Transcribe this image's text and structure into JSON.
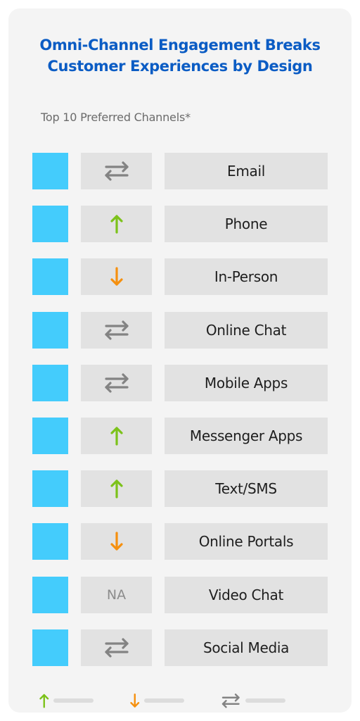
{
  "title_line1": "Omni-Channel Engagement Breaks",
  "title_line2": "Customer Experiences by Design",
  "subtitle": "Top 10 Preferred Channels*",
  "colors": {
    "swatch": "#44ccfc",
    "up": "#7cc21a",
    "down": "#f5900f",
    "same": "#838383",
    "title": "#0b5cc4"
  },
  "channels": [
    {
      "label": "Email",
      "trend": "same"
    },
    {
      "label": "Phone",
      "trend": "up"
    },
    {
      "label": "In-Person",
      "trend": "down"
    },
    {
      "label": "Online Chat",
      "trend": "same"
    },
    {
      "label": "Mobile Apps",
      "trend": "same"
    },
    {
      "label": "Messenger Apps",
      "trend": "up"
    },
    {
      "label": "Text/SMS",
      "trend": "up"
    },
    {
      "label": "Online Portals",
      "trend": "down"
    },
    {
      "label": "Video Chat",
      "trend": "na",
      "trend_text": "NA"
    },
    {
      "label": "Social Media",
      "trend": "same"
    }
  ],
  "legend": [
    {
      "icon": "arrow-up-icon",
      "trend": "up",
      "label": ""
    },
    {
      "icon": "arrow-down-icon",
      "trend": "down",
      "label": ""
    },
    {
      "icon": "arrows-exchange-icon",
      "trend": "same",
      "label": ""
    }
  ]
}
